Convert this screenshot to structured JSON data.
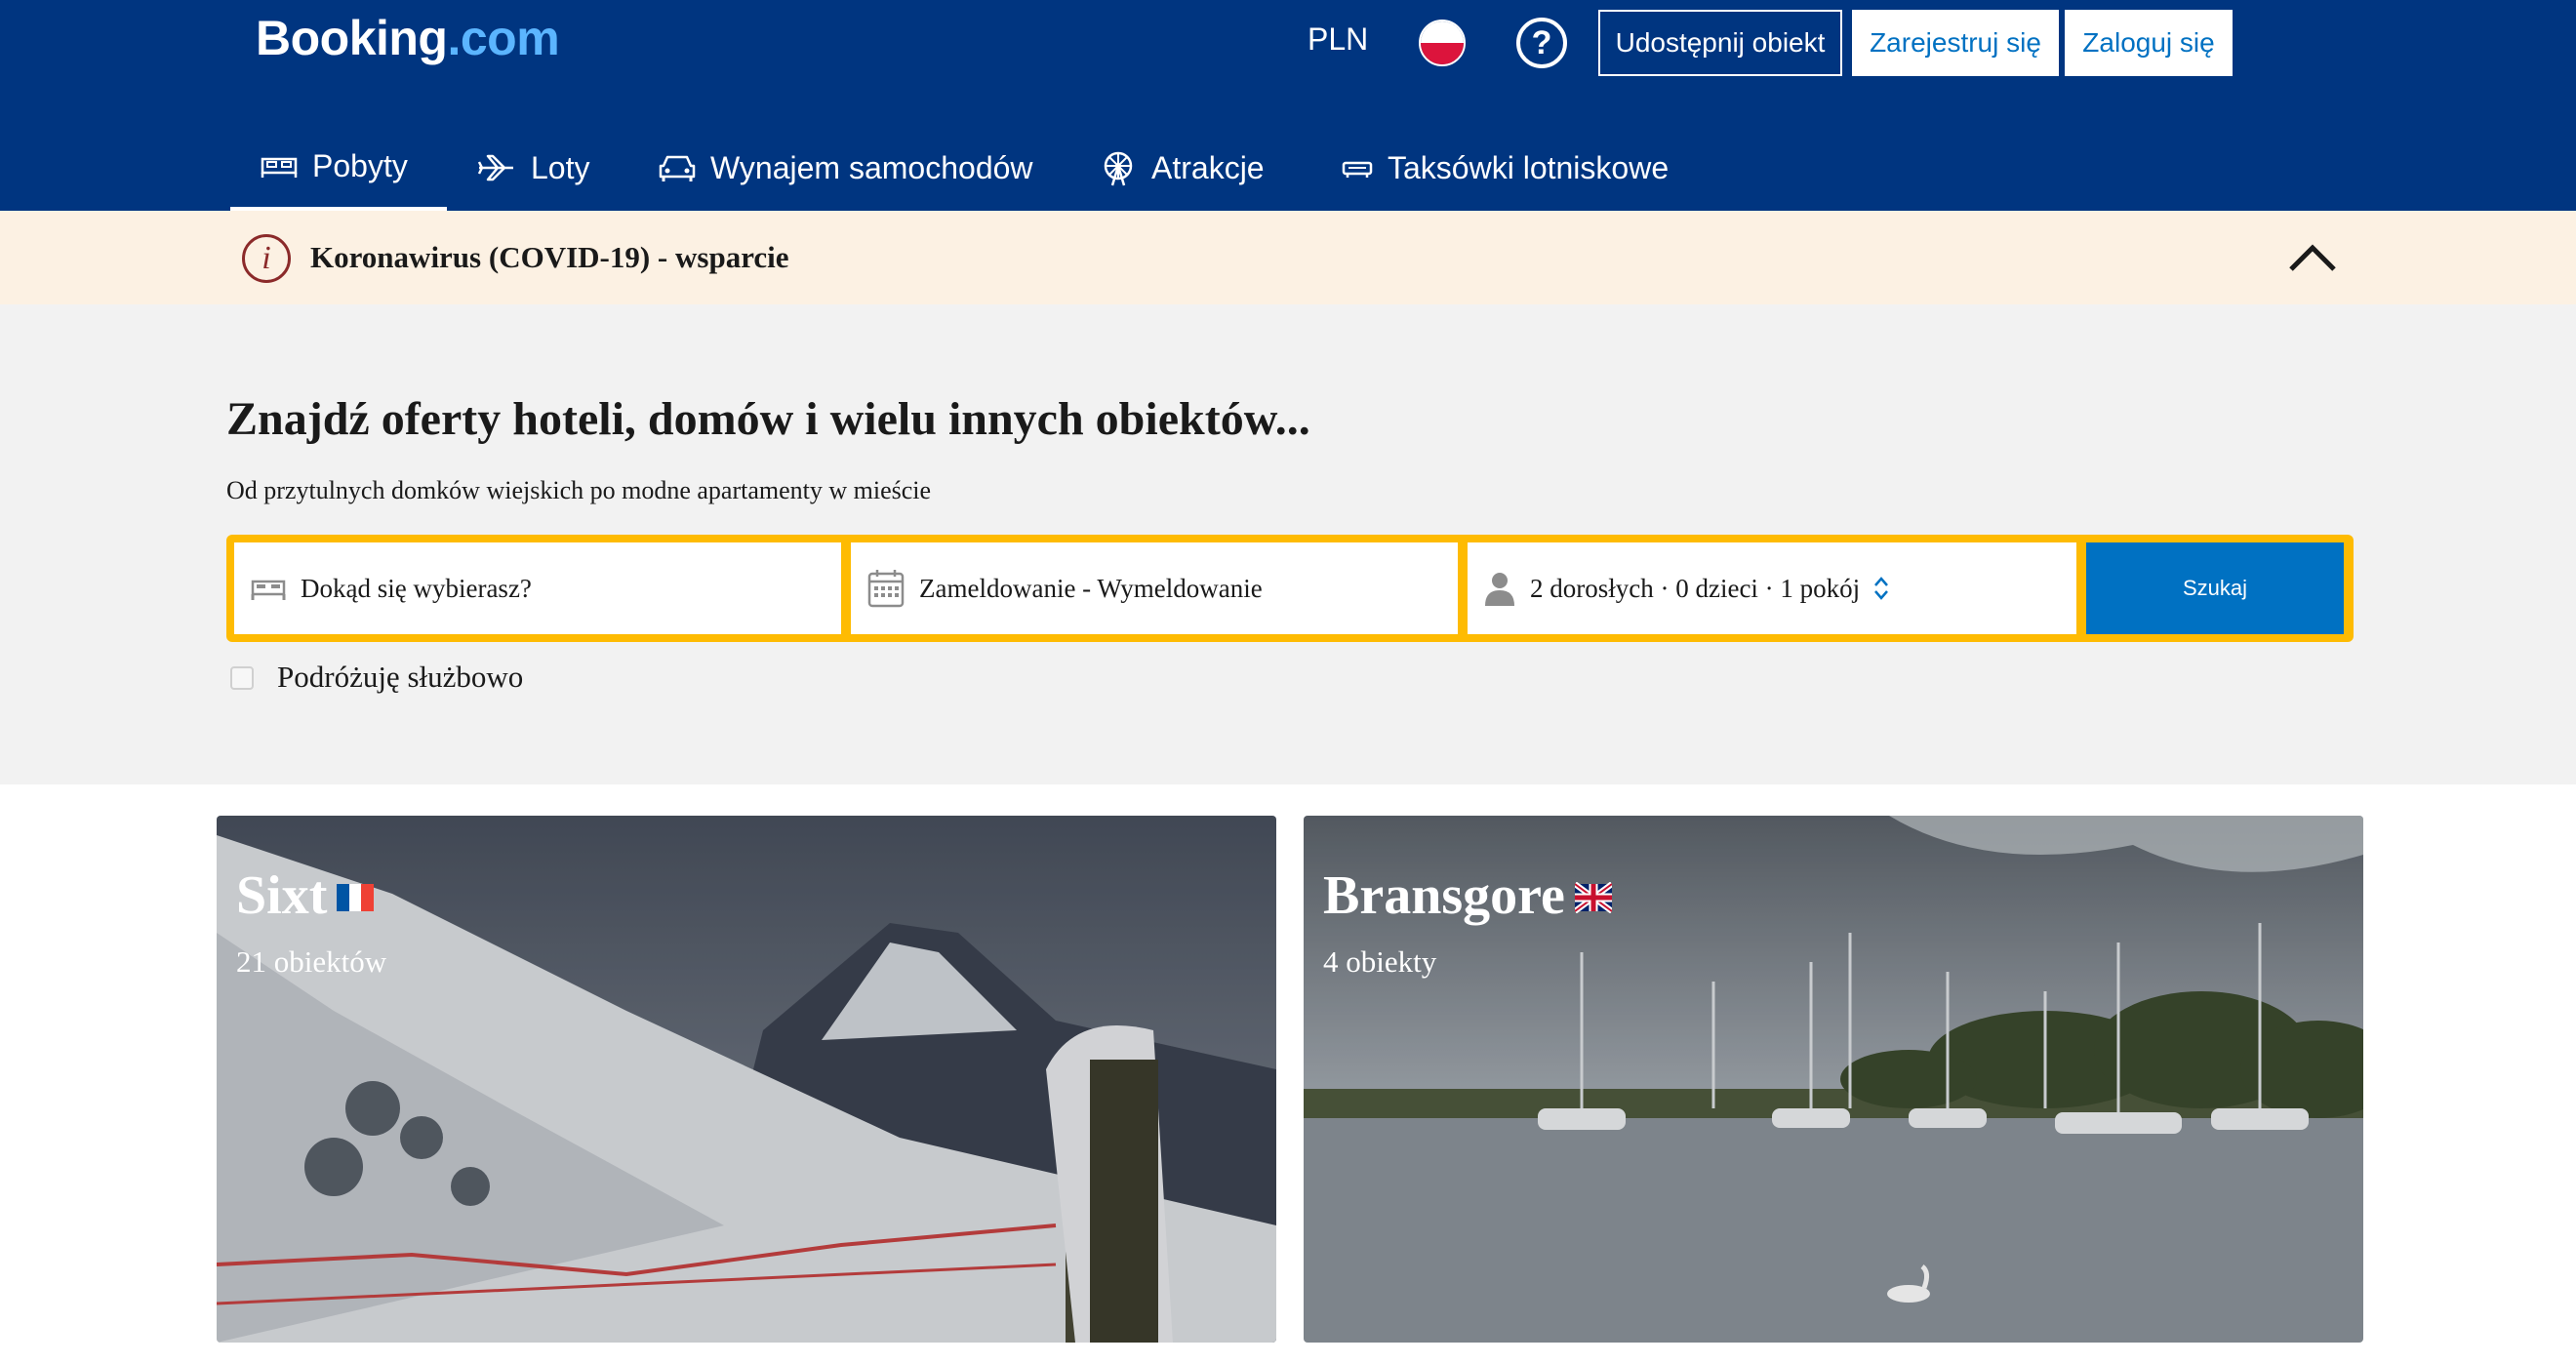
{
  "header": {
    "logo_main": "Booking",
    "logo_suffix": ".com",
    "currency": "PLN",
    "help_glyph": "?",
    "list_property": "Udostępnij obiekt",
    "register": "Zarejestruj się",
    "login": "Zaloguj się"
  },
  "nav": {
    "stays": "Pobyty",
    "flights": "Loty",
    "car_rental": "Wynajem samochodów",
    "attractions": "Atrakcje",
    "airport_taxis": "Taksówki lotniskowe"
  },
  "covid_banner": {
    "info_glyph": "i",
    "text": "Koronawirus (COVID-19) - wsparcie"
  },
  "hero": {
    "title": "Znajdź oferty hoteli, domów i wielu innych obiektów...",
    "subtitle": "Od przytulnych domków wiejskich po modne apartamenty w mieście"
  },
  "search": {
    "destination_placeholder": "Dokąd się wybierasz?",
    "dates_placeholder": "Zameldowanie - Wymeldowanie",
    "guests_value": "2 dorosłych · 0 dzieci · 1 pokój",
    "submit": "Szukaj",
    "business_travel": "Podróżuję służbowo"
  },
  "destinations": [
    {
      "name": "Sixt",
      "count": "21 obiektów",
      "flag": "france-flag-icon"
    },
    {
      "name": "Bransgore",
      "count": "4 obiekty",
      "flag": "uk-flag-icon"
    }
  ],
  "colors": {
    "brand_blue": "#003580",
    "search_yellow": "#febb02",
    "button_blue": "#0071c2",
    "covid_bg": "#fcf1e3"
  }
}
